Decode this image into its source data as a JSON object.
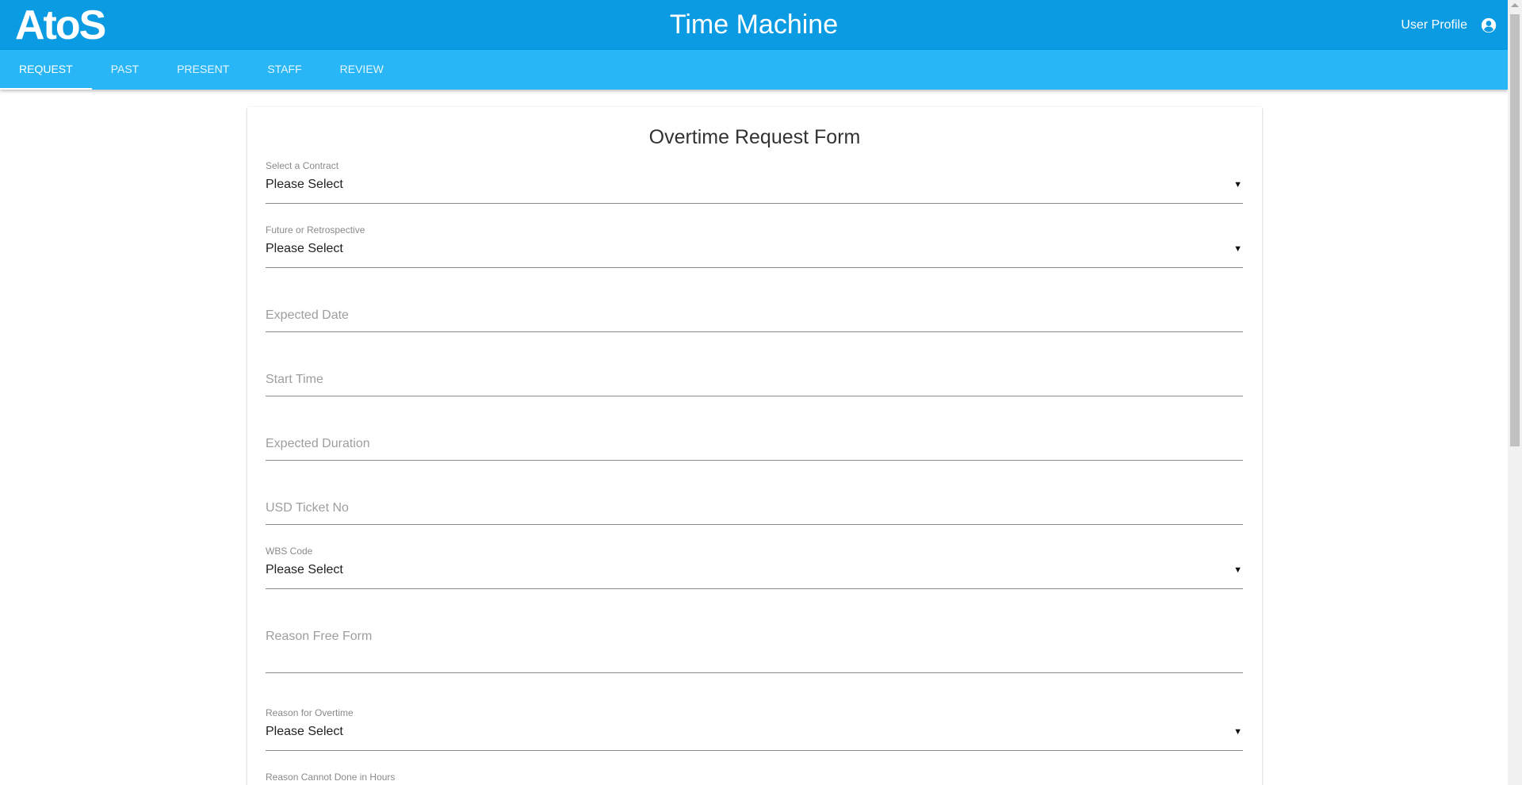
{
  "header": {
    "logo_text": "AtoS",
    "app_title": "Time Machine",
    "profile_label": "User Profile",
    "profile_icon": "account-circle-icon"
  },
  "tabs": [
    {
      "label": "REQUEST",
      "active": true
    },
    {
      "label": "PAST",
      "active": false
    },
    {
      "label": "PRESENT",
      "active": false
    },
    {
      "label": "STAFF",
      "active": false
    },
    {
      "label": "REVIEW",
      "active": false
    }
  ],
  "form": {
    "title": "Overtime Request Form",
    "contract": {
      "label": "Select a Contract",
      "value": "Please Select"
    },
    "future_retro": {
      "label": "Future or Retrospective",
      "value": "Please Select"
    },
    "expected_date": {
      "placeholder": "Expected Date"
    },
    "start_time": {
      "placeholder": "Start Time"
    },
    "expected_duration": {
      "placeholder": "Expected Duration"
    },
    "usd_ticket": {
      "placeholder": "USD Ticket No"
    },
    "wbs_code": {
      "label": "WBS Code",
      "value": "Please Select"
    },
    "reason_free": {
      "placeholder": "Reason Free Form"
    },
    "reason_overtime": {
      "label": "Reason for Overtime",
      "value": "Please Select"
    },
    "reason_cannot": {
      "label": "Reason Cannot Done in Hours"
    }
  },
  "colors": {
    "header_bg": "#0b9be3",
    "tabbar_bg": "#29b6f6",
    "text": "#212121",
    "muted": "#8a8a8a"
  }
}
